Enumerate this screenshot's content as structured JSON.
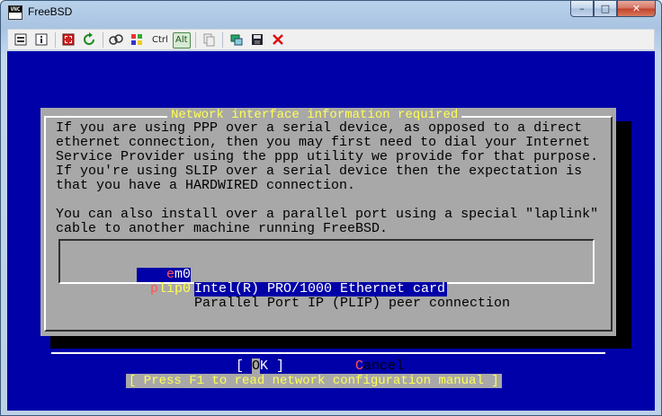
{
  "window": {
    "title": "FreeBSD",
    "app_icon_top": "VNC",
    "minimize": "–",
    "maximize": "□",
    "close": "✕"
  },
  "toolbar": {
    "ctrl_label": "Ctrl",
    "alt_label": "Alt"
  },
  "dialog": {
    "title": "Network interface information required",
    "body": "If you are using PPP over a serial device, as opposed to a direct\nethernet connection, then you may first need to dial your Internet\nService Provider using the ppp utility we provide for that purpose.\nIf you're using SLIP over a serial device then the expectation is\nthat you have a HARDWIRED connection.\n\nYou can also install over a parallel port using a special \"laplink\"\ncable to another machine running FreeBSD.",
    "interfaces": [
      {
        "hot": "e",
        "rest": "m0",
        "description": "Intel(R) PRO/1000 Ethernet card",
        "selected": true
      },
      {
        "hot": "p",
        "rest": "lip0",
        "description": "Parallel Port IP (PLIP) peer connection",
        "selected": false
      }
    ],
    "ok_left": "[ ",
    "ok_hot": "O",
    "ok_rest": "K ]",
    "cancel_hot": "C",
    "cancel_rest": "ancel",
    "help": "[ Press F1 to read network configuration manual ]"
  },
  "colors": {
    "screen_bg": "#0000a8",
    "dialog_bg": "#a8a8a8",
    "title_yellow": "#ffff54",
    "hotkey_red": "#ff5454"
  }
}
